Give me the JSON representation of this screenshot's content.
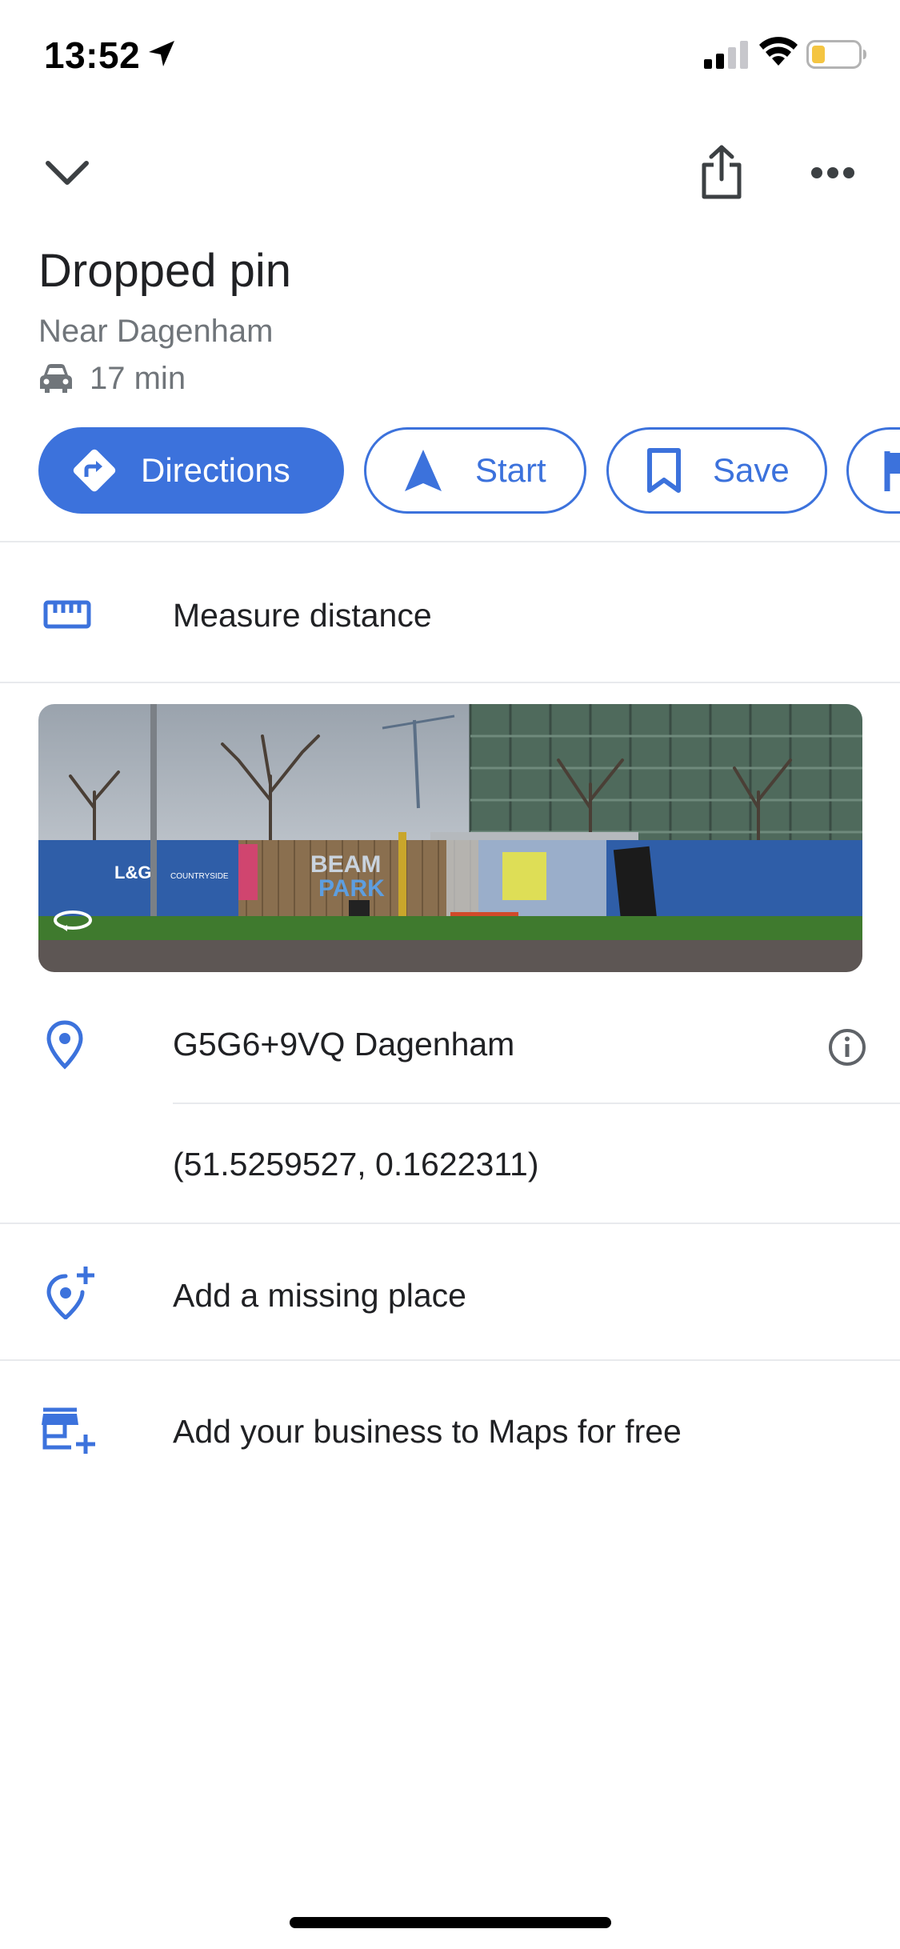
{
  "status_bar": {
    "time": "13:52"
  },
  "place": {
    "title": "Dropped pin",
    "subtitle": "Near Dagenham",
    "drive_time": "17 min"
  },
  "actions": {
    "directions": "Directions",
    "start": "Start",
    "save": "Save"
  },
  "rows": {
    "measure_distance": "Measure distance",
    "plus_code": "G5G6+9VQ Dagenham",
    "coordinates": "(51.5259527, 0.1622311)",
    "add_missing_place": "Add a missing place",
    "add_business": "Add your business to Maps for free"
  },
  "street_view": {
    "signs": [
      "L&G",
      "COUNTRYSIDE",
      "BEAM",
      "PARK"
    ]
  },
  "colors": {
    "accent": "#3c72dc",
    "text_primary": "#202124",
    "text_secondary": "#70757a",
    "divider": "#e8eaed",
    "battery_level": "#f4c542"
  },
  "icons": {
    "collapse": "chevron-down-icon",
    "share": "share-icon",
    "more": "more-horizontal-icon",
    "car": "car-icon",
    "directions": "directions-icon",
    "start": "navigation-arrow-icon",
    "save": "bookmark-icon",
    "measure": "ruler-icon",
    "pin": "location-pin-icon",
    "info": "info-icon",
    "add_place": "add-location-icon",
    "add_business": "add-business-icon",
    "street_view": "street-view-360-icon"
  }
}
